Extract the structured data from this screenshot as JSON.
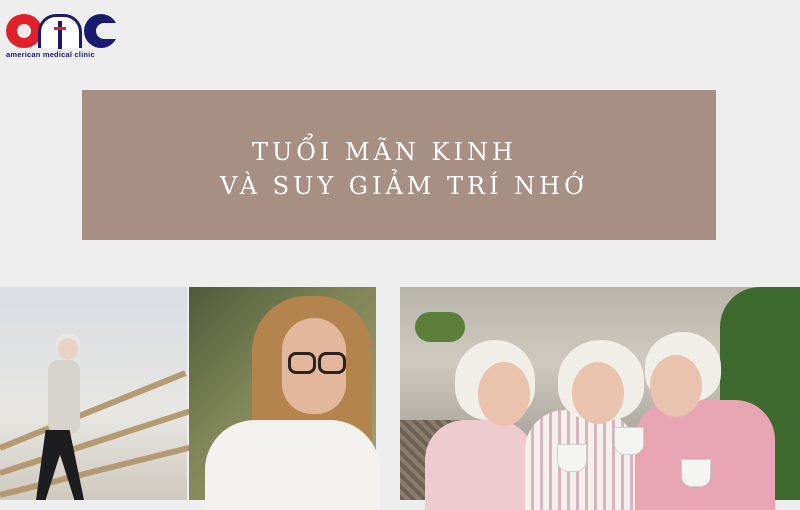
{
  "logo": {
    "brand_letters": "amc",
    "subtitle": "american medical clinic"
  },
  "banner": {
    "title_line1": "TUỔI MÃN KINH",
    "title_line2": "VÀ SUY GIẢM TRÍ NHỚ",
    "background_color": "#a78f83"
  },
  "photos": [
    {
      "subject": "older woman jogging on bridge"
    },
    {
      "subject": "woman with glasses writing"
    },
    {
      "subject": "three older women drinking coffee"
    }
  ]
}
